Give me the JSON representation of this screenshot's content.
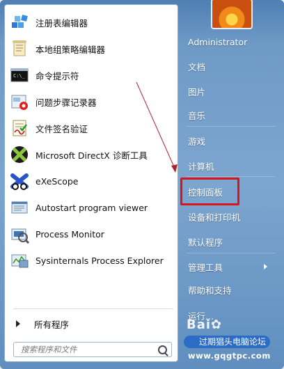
{
  "left_pane": {
    "programs": [
      {
        "label": "注册表编辑器",
        "icon": "registry-editor-icon"
      },
      {
        "label": "本地组策略编辑器",
        "icon": "group-policy-icon"
      },
      {
        "label": "命令提示符",
        "icon": "cmd-icon"
      },
      {
        "label": "问题步骤记录器",
        "icon": "steps-recorder-icon"
      },
      {
        "label": "文件签名验证",
        "icon": "sigverif-icon"
      },
      {
        "label": "Microsoft DirectX 诊断工具",
        "icon": "directx-icon"
      },
      {
        "label": "eXeScope",
        "icon": "exescope-icon"
      },
      {
        "label": "Autostart program viewer",
        "icon": "autoruns-icon"
      },
      {
        "label": "Process Monitor",
        "icon": "procmon-icon"
      },
      {
        "label": "Sysinternals Process Explorer",
        "icon": "procexp-icon"
      }
    ],
    "all_programs": "所有程序",
    "search_placeholder": "搜索程序和文件"
  },
  "right_pane": {
    "items": [
      {
        "label": "Administrator"
      },
      {
        "label": "文档"
      },
      {
        "label": "图片"
      },
      {
        "label": "音乐"
      },
      {
        "label": "游戏"
      },
      {
        "label": "计算机"
      },
      {
        "label": "控制面板"
      },
      {
        "label": "设备和打印机"
      },
      {
        "label": "默认程序"
      },
      {
        "label": "管理工具"
      },
      {
        "label": "帮助和支持"
      },
      {
        "label": "运行..."
      }
    ]
  },
  "watermark": {
    "title": "过期猖头电脑论坛",
    "url": "www.gqgtpc.com"
  },
  "colors": {
    "highlight": "#d8141c",
    "menu_blue": "#6e9ac6"
  }
}
